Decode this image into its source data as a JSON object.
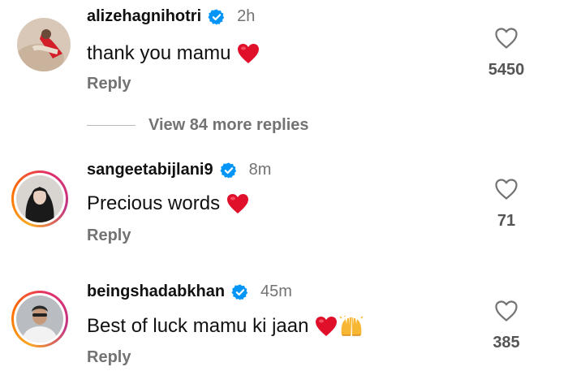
{
  "comments": [
    {
      "username": "alizehagnihotri",
      "verified": true,
      "time": "2h",
      "text": "thank you mamu",
      "emojis": [
        "red-heart"
      ],
      "reply_label": "Reply",
      "likes": "5450"
    },
    {
      "username": "sangeetabijlani9",
      "verified": true,
      "time": "8m",
      "text": "Precious words",
      "emojis": [
        "red-heart"
      ],
      "reply_label": "Reply",
      "likes": "71"
    },
    {
      "username": "beingshadabkhan",
      "verified": true,
      "time": "45m",
      "text": "Best of luck mamu ki jaan",
      "emojis": [
        "red-heart",
        "raising-hands"
      ],
      "reply_label": "Reply",
      "likes": "385"
    }
  ],
  "view_more_label": "View 84 more replies",
  "colors": {
    "verified_blue": "#0095f6",
    "heart_red": "#e0102b",
    "muted_text": "#737373",
    "story_ring": [
      "#f9a825",
      "#ff6d00",
      "#e1306c",
      "#c13584"
    ]
  },
  "icons": {
    "verified": "verified-badge-icon",
    "like": "heart-outline-icon",
    "red_heart": "red-heart-emoji",
    "raising_hands": "raising-hands-emoji"
  }
}
